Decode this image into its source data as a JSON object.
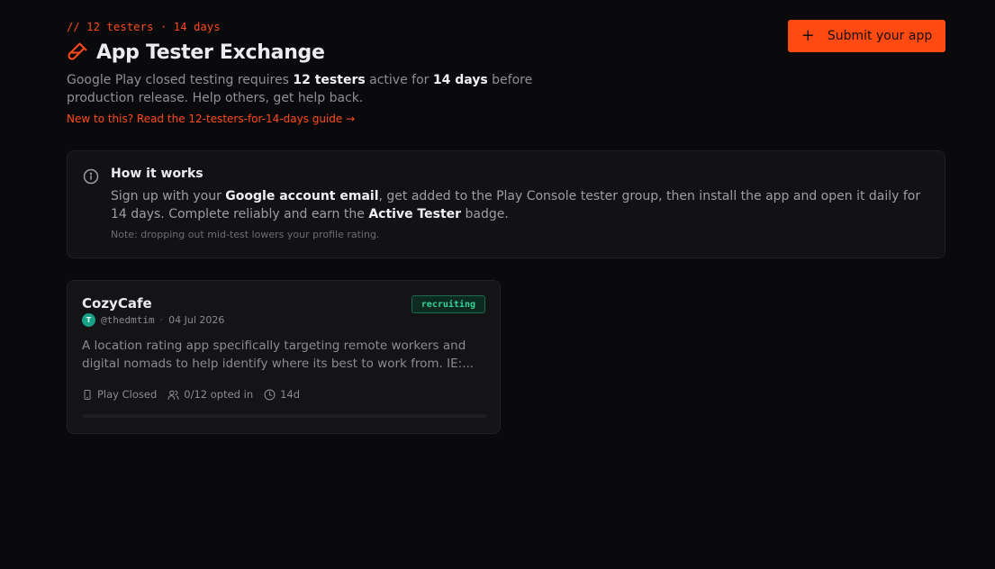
{
  "header": {
    "eyebrow": "// 12 testers · 14 days",
    "title": "App Tester Exchange",
    "desc_1": "Google Play closed testing requires ",
    "desc_b1": "12 testers",
    "desc_2": " active for ",
    "desc_b2": "14 days",
    "desc_3": " before production release. Help others, get help back.",
    "guide_link": "New to this? Read the 12-testers-for-14-days guide →"
  },
  "submit_button": {
    "label": "Submit your app",
    "icon": "plus-icon"
  },
  "how_it_works": {
    "title": "How it works",
    "text_1": "Sign up with your ",
    "text_b1": "Google account email",
    "text_2": ", get added to the Play Console tester group, then install the app and open it daily for 14 days. Complete reliably and earn the ",
    "text_b2": "Active Tester",
    "text_3": " badge.",
    "note": "Note: dropping out mid-test lowers your profile rating."
  },
  "apps": [
    {
      "name": "CozyCafe",
      "status": "recruiting",
      "avatar_letter": "T",
      "handle": "@thedmtim",
      "separator": "·",
      "date": "04 Jul 2026",
      "description": "A location rating app specifically targeting remote workers and digital nomads to help identify where its best to work from. IE:...",
      "platform": "Play Closed",
      "opted_in": "0/12 opted in",
      "duration": "14d",
      "progress": 0
    }
  ],
  "colors": {
    "accent": "#ff4a12",
    "status_green": "#34d39a",
    "background": "#0a0a0c"
  }
}
